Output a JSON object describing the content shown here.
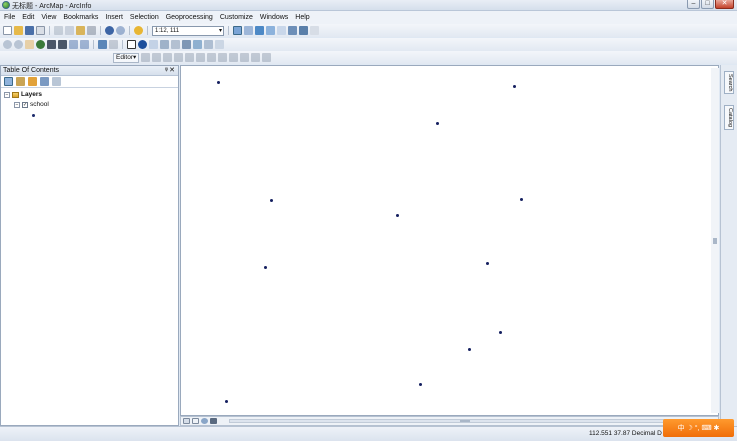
{
  "window": {
    "title": "无标题 - ArcMap - ArcInfo",
    "min_label": "–",
    "max_label": "□",
    "close_label": "✕"
  },
  "menu": {
    "items": [
      "File",
      "Edit",
      "View",
      "Bookmarks",
      "Insert",
      "Selection",
      "Geoprocessing",
      "Customize",
      "Windows",
      "Help"
    ]
  },
  "toolbar": {
    "scale_value": "1:12, 111",
    "editor_label": "Editor▾"
  },
  "toc": {
    "title": "Table Of Contents",
    "pin_label": "ᵠ",
    "close_label": "✕",
    "layers_label": "Layers",
    "layer_name": "school",
    "layer_checked": true
  },
  "map": {
    "point_color": "#152060",
    "point_count": 14
  },
  "right_dock": {
    "tabs": [
      "Search",
      "Catalog"
    ]
  },
  "status": {
    "coords": "112.551  37.87 Decimal D"
  },
  "ime": {
    "label": "中 ☽ °, ⌨ ✱"
  },
  "colors": {
    "accent": "#3c6a8a",
    "ime": "#f07a14",
    "point": "#152060"
  }
}
